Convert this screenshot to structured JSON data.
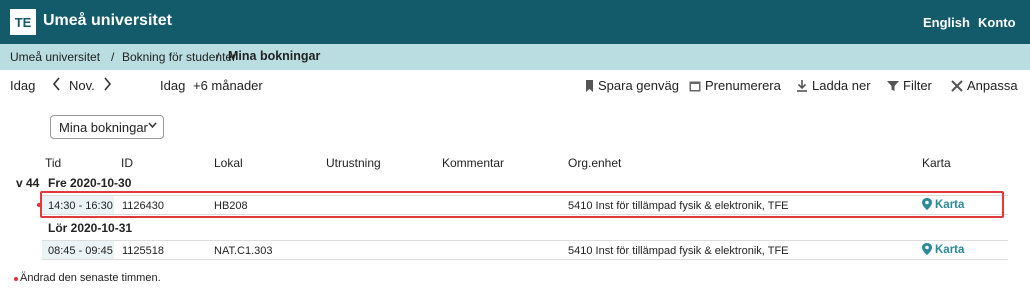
{
  "header": {
    "logo": "TE",
    "title": "Umeå universitet",
    "english_label": "English",
    "konto_label": "Konto"
  },
  "breadcrumb": {
    "item1": "Umeå universitet",
    "sep1": "/",
    "item2": "Bokning för studenter",
    "sep2": "/",
    "current": "Mina bokningar"
  },
  "toolbar": {
    "idag": "Idag",
    "month": "Nov.",
    "idag2": "Idag",
    "range": "+6 månader",
    "spara": "Spara genväg",
    "prenumerera": "Prenumerera",
    "ladda": "Ladda ner",
    "filter": "Filter",
    "anpassa": "Anpassa"
  },
  "filter_select": {
    "value": "Mina bokningar"
  },
  "columns": {
    "tid": "Tid",
    "id": "ID",
    "lokal": "Lokal",
    "utrustning": "Utrustning",
    "kommentar": "Kommentar",
    "org": "Org.enhet",
    "karta": "Karta"
  },
  "week": "v 44",
  "days": [
    {
      "label": "Fre 2020-10-30",
      "time": "14:30 - 16:30",
      "id": "1126430",
      "lokal": "HB208",
      "org": "5410 Inst för tillämpad fysik & elektronik, TFE",
      "karta": "Karta"
    },
    {
      "label": "Lör 2020-10-31",
      "time": "08:45 - 09:45",
      "id": "1125518",
      "lokal": "NAT.C1.303",
      "org": "5410 Inst för tillämpad fysik & elektronik, TFE",
      "karta": "Karta"
    }
  ],
  "footnote": "Ändrad den senaste timmen.",
  "colors": {
    "header": "#135a6a",
    "breadcrumb": "#b9dde0",
    "accent": "#2a8a9a",
    "highlight": "#e03a3a"
  }
}
